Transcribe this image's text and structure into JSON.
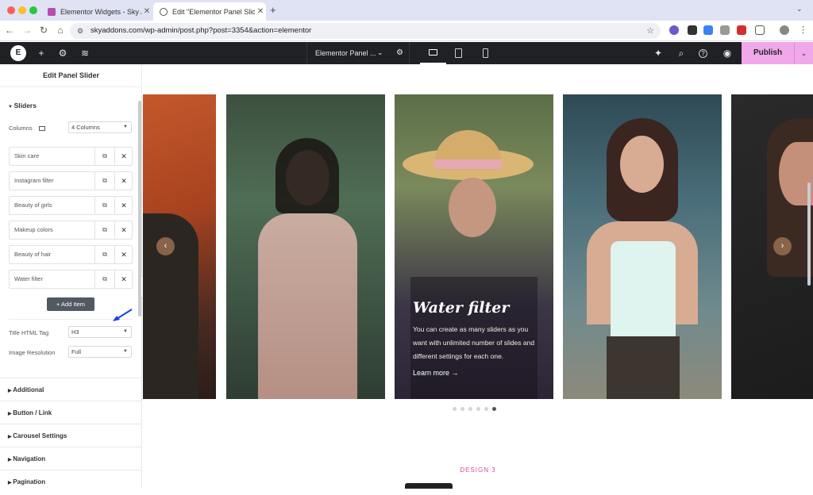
{
  "browser": {
    "tabs": [
      {
        "title": "Elementor Widgets - Sky Addons",
        "active": false
      },
      {
        "title": "Edit \"Elementor Panel Slider\"",
        "active": true
      }
    ],
    "new_tab": "+",
    "url": "skyaddons.com/wp-admin/post.php?post=3354&action=elementor",
    "colors": {
      "tabbar": "#dfe3f4",
      "close": "#ff5f57",
      "min": "#febc2e",
      "max": "#28c840"
    }
  },
  "editor": {
    "logo": "E",
    "document_title": "Elementor Panel ...",
    "publish_label": "Publish",
    "publish_color": "#f0a8ea"
  },
  "panel": {
    "title": "Edit Panel Slider",
    "sliders_section": "Sliders",
    "columns_label": "Columns",
    "columns_value": "4 Columns",
    "items": [
      {
        "label": "Skin care"
      },
      {
        "label": "Instagram filter"
      },
      {
        "label": "Beauty of girls"
      },
      {
        "label": "Makeup colors"
      },
      {
        "label": "Beauty of hair"
      },
      {
        "label": "Water filter"
      }
    ],
    "add_item_label": "Add Item",
    "title_tag_label": "Title HTML Tag",
    "title_tag_value": "H3",
    "image_resolution_label": "Image Resolution",
    "image_resolution_value": "Full",
    "accordions": [
      {
        "label": "Additional"
      },
      {
        "label": "Button / Link"
      },
      {
        "label": "Carousel Settings"
      },
      {
        "label": "Navigation"
      },
      {
        "label": "Pagination"
      }
    ]
  },
  "preview": {
    "caption_title": "Water filter",
    "caption_body": "You can create as many sliders as you want with unlimited number of slides and different settings for each one.",
    "caption_link": "Learn more",
    "pagination_count": 6,
    "active_dot": 6,
    "section_label": "DESIGN 3"
  }
}
